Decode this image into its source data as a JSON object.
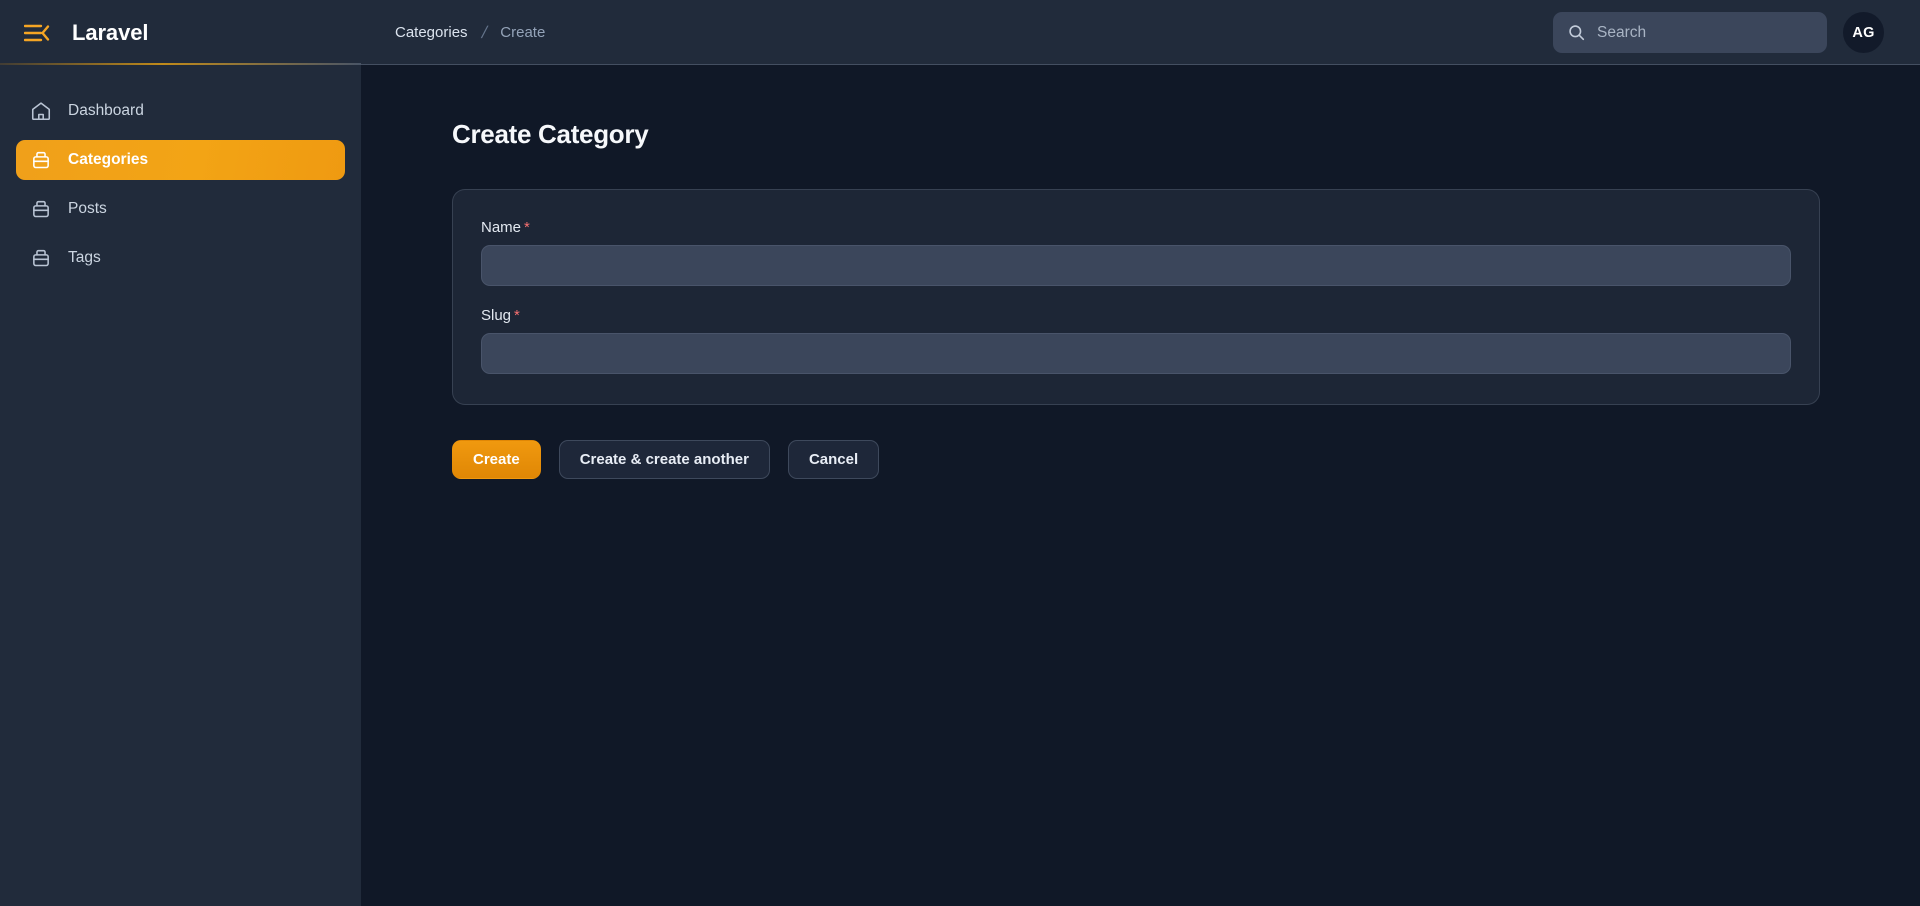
{
  "sidebar": {
    "brand": "Laravel",
    "toggle_icon": "collapse-sidebar-icon",
    "items": [
      {
        "label": "Dashboard",
        "icon": "home-icon",
        "active": false
      },
      {
        "label": "Categories",
        "icon": "archive-box-icon",
        "active": true
      },
      {
        "label": "Posts",
        "icon": "archive-box-icon",
        "active": false
      },
      {
        "label": "Tags",
        "icon": "archive-box-icon",
        "active": false
      }
    ]
  },
  "topbar": {
    "breadcrumb": {
      "parent": "Categories",
      "separator": "/",
      "current": "Create"
    },
    "search": {
      "icon": "search-icon",
      "placeholder": "Search",
      "value": ""
    },
    "avatar": {
      "initials": "AG"
    }
  },
  "page": {
    "title": "Create Category",
    "form": {
      "fields": [
        {
          "label": "Name",
          "required_marker": "*",
          "value": "",
          "placeholder": ""
        },
        {
          "label": "Slug",
          "required_marker": "*",
          "value": "",
          "placeholder": ""
        }
      ]
    },
    "actions": {
      "create": "Create",
      "create_another": "Create & create another",
      "cancel": "Cancel"
    }
  },
  "colors": {
    "accent": "#f3a415",
    "primary_button": "#e98c07",
    "sidebar_bg": "#212b3b",
    "main_bg": "#101827",
    "card_bg": "#1d2636",
    "input_bg": "#3b465b",
    "required_marker": "#f87171"
  }
}
